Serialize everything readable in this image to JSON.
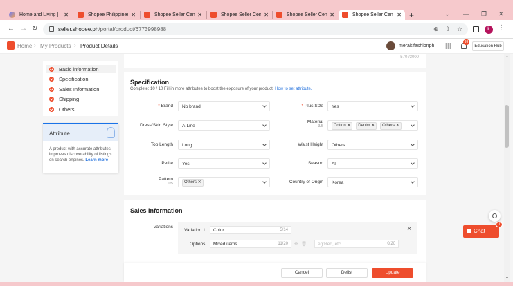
{
  "browser": {
    "tabs": [
      {
        "label": "Home and Living |",
        "active": false
      },
      {
        "label": "Shopee Philippines",
        "active": false
      },
      {
        "label": "Shopee Seller Cen",
        "active": false
      },
      {
        "label": "Shopee Seller Cen",
        "active": false
      },
      {
        "label": "Shopee Seller Cen",
        "active": false
      },
      {
        "label": "Shopee Seller Cen",
        "active": true
      }
    ],
    "close_glyph": "✕",
    "new_tab_glyph": "+",
    "url_host": "seller.shopee.ph",
    "url_path": "/portal/product/6773998988",
    "profile_initial": "k"
  },
  "header": {
    "crumbs": [
      "Home",
      "My Products",
      "Product Details"
    ],
    "shop_name": "merakifashionph",
    "notification_count": "99",
    "education_hub": "Education Hub"
  },
  "nav": {
    "items": [
      "Basic information",
      "Specification",
      "Sales Information",
      "Shipping",
      "Others"
    ]
  },
  "attribute_tip": {
    "title": "Attribute",
    "text": "A product with accurate attributes improves discoverability of listings on search engines.",
    "link": "Learn more"
  },
  "top_card": {
    "char_count": "570 /3000"
  },
  "specification": {
    "title": "Specification",
    "complete_text": "Complete: 10 / 10 Fill in more attributes to boost the exposure of your product.",
    "complete_link": "How to set attribute.",
    "fields": {
      "brand": {
        "label": "Brand",
        "value": "No brand"
      },
      "plus_size": {
        "label": "Plus Size",
        "value": "Yes"
      },
      "dress_style": {
        "label": "Dress/Skirt Style",
        "value": "A-Line"
      },
      "material": {
        "label": "Material",
        "sub": "3/5",
        "tags": [
          "Cotton",
          "Denim",
          "Others"
        ]
      },
      "top_length": {
        "label": "Top Length",
        "value": "Long"
      },
      "waist_height": {
        "label": "Waist Height",
        "value": "Others"
      },
      "petite": {
        "label": "Petite",
        "value": "Yes"
      },
      "season": {
        "label": "Season",
        "value": "All"
      },
      "pattern": {
        "label": "Pattern",
        "sub": "1/5",
        "tags": [
          "Others"
        ]
      },
      "country": {
        "label": "Country of Origin",
        "value": "Korea"
      }
    }
  },
  "sales": {
    "title": "Sales Information",
    "variations_label": "Variations",
    "variation1_label": "Variation 1",
    "variation1_value": "Color",
    "variation1_count": "5/14",
    "options_label": "Options",
    "option_value": "Mixed items",
    "option_count": "11/20",
    "option_placeholder": "eg:Red, etc.",
    "option_placeholder_count": "0/20"
  },
  "actions": {
    "cancel": "Cancel",
    "delist": "Delist",
    "update": "Update"
  },
  "chat": {
    "label": "Chat",
    "badge": "10"
  },
  "colors": {
    "brand": "#ee4d2d",
    "link": "#2673dd"
  }
}
